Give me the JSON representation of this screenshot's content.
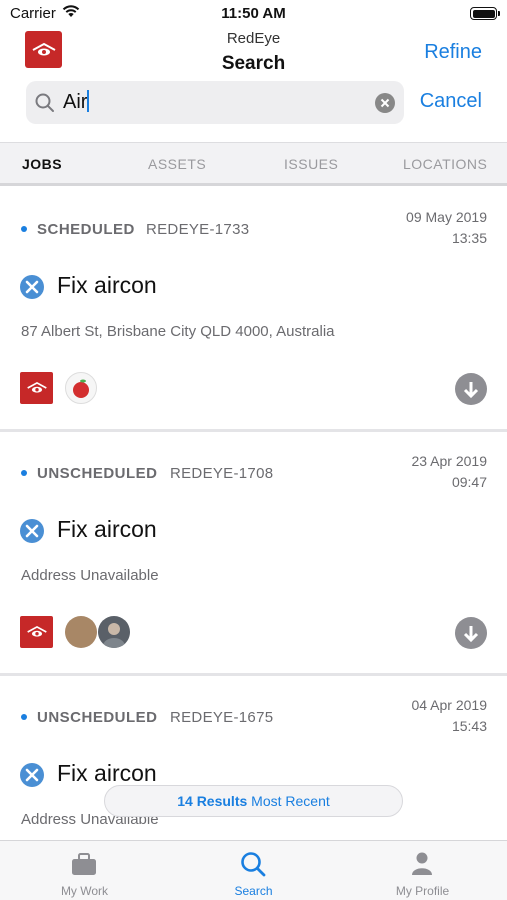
{
  "status_bar": {
    "carrier": "Carrier",
    "time": "11:50 AM"
  },
  "header": {
    "app_name": "RedEye",
    "title": "Search",
    "refine_label": "Refine",
    "logo_text": "REDEYE"
  },
  "search": {
    "query": "Air",
    "cancel_label": "Cancel"
  },
  "tabs": [
    {
      "label": "JOBS",
      "active": true
    },
    {
      "label": "ASSETS",
      "active": false
    },
    {
      "label": "ISSUES",
      "active": false
    },
    {
      "label": "LOCATIONS",
      "active": false
    }
  ],
  "jobs": [
    {
      "status": "SCHEDULED",
      "id": "REDEYE-1733",
      "date": "09 May 2019",
      "time": "13:35",
      "title": "Fix aircon",
      "address": "87 Albert St, Brisbane City QLD 4000, Australia"
    },
    {
      "status": "UNSCHEDULED",
      "id": "REDEYE-1708",
      "date": "23 Apr 2019",
      "time": "09:47",
      "title": "Fix aircon",
      "address": "Address Unavailable"
    },
    {
      "status": "UNSCHEDULED",
      "id": "REDEYE-1675",
      "date": "04 Apr 2019",
      "time": "15:43",
      "title": "Fix aircon",
      "address": "Address Unavailable"
    }
  ],
  "results": {
    "count_label": "14 Results",
    "sort_label": "Most Recent"
  },
  "tab_bar": [
    {
      "label": "My Work",
      "icon": "briefcase-icon",
      "active": false
    },
    {
      "label": "Search",
      "icon": "search-icon",
      "active": true
    },
    {
      "label": "My Profile",
      "icon": "person-icon",
      "active": false
    }
  ],
  "colors": {
    "accent": "#1a7fe0",
    "brand": "#c62828",
    "status_dot": "#1a7fe0"
  }
}
